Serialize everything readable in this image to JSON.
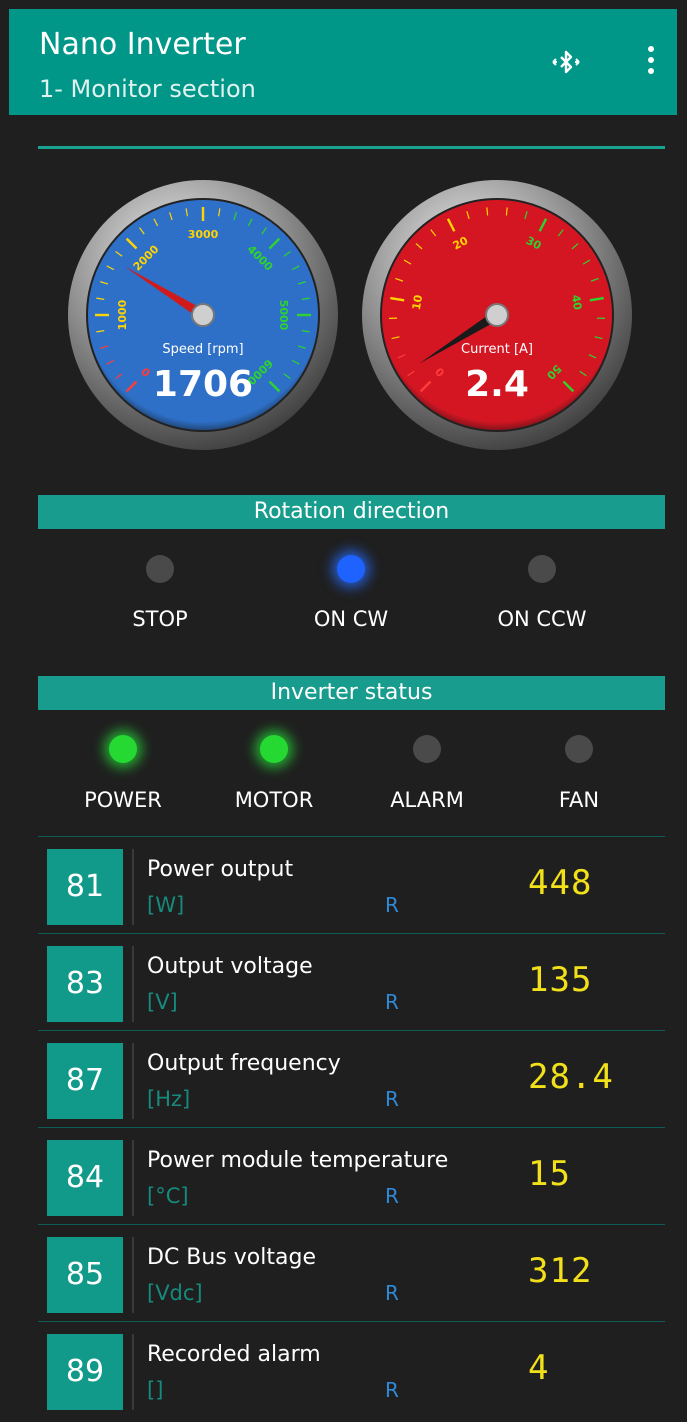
{
  "header": {
    "title": "Nano Inverter",
    "subtitle": "1- Monitor section",
    "bluetooth_icon": "bluetooth-icon",
    "menu_icon": "more-vert-icon",
    "color": "#009688"
  },
  "gauges": [
    {
      "caption": "Speed [rpm]",
      "value": "1706",
      "face_color": "#2e70c7",
      "ticks": [
        "0",
        "1000",
        "2000",
        "3000",
        "4000",
        "5000",
        "6000"
      ],
      "needle_value": 1706,
      "scale_max": 6000
    },
    {
      "caption": "Current [A]",
      "value": "2.4",
      "face_color": "#d41623",
      "ticks": [
        "0",
        "10",
        "20",
        "30",
        "40",
        "50"
      ],
      "needle_value": 2.4,
      "scale_max": 50
    }
  ],
  "rotation": {
    "title": "Rotation direction",
    "items": [
      {
        "label": "STOP",
        "state": "off"
      },
      {
        "label": "ON CW",
        "state": "blue"
      },
      {
        "label": "ON CCW",
        "state": "off"
      }
    ]
  },
  "status": {
    "title": "Inverter status",
    "items": [
      {
        "label": "POWER",
        "state": "green"
      },
      {
        "label": "MOTOR",
        "state": "green"
      },
      {
        "label": "ALARM",
        "state": "off"
      },
      {
        "label": "FAN",
        "state": "off"
      }
    ]
  },
  "params": [
    {
      "id": "81",
      "name": "Power output",
      "unit": "[W]",
      "mode": "R",
      "value": "448"
    },
    {
      "id": "83",
      "name": "Output voltage",
      "unit": "[V]",
      "mode": "R",
      "value": "135"
    },
    {
      "id": "87",
      "name": "Output frequency",
      "unit": "[Hz]",
      "mode": "R",
      "value": "28.4"
    },
    {
      "id": "84",
      "name": "Power module temperature",
      "unit": "[°C]",
      "mode": "R",
      "value": "15"
    },
    {
      "id": "85",
      "name": "DC Bus voltage",
      "unit": "[Vdc]",
      "mode": "R",
      "value": "312"
    },
    {
      "id": "89",
      "name": "Recorded alarm",
      "unit": "[]",
      "mode": "R",
      "value": "4"
    }
  ]
}
